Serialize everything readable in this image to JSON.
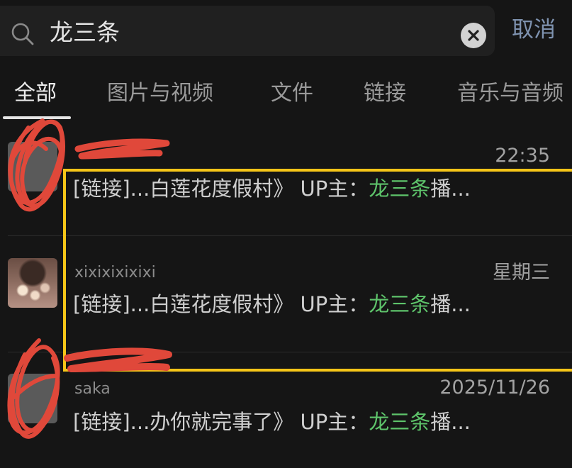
{
  "search": {
    "query": "龙三条",
    "cancel_label": "取消"
  },
  "tabs": [
    {
      "label": "全部",
      "active": true
    },
    {
      "label": "图片与视频",
      "active": false
    },
    {
      "label": "文件",
      "active": false
    },
    {
      "label": "链接",
      "active": false
    },
    {
      "label": "音乐与音频",
      "active": false
    }
  ],
  "results": [
    {
      "name": "",
      "time": "22:35",
      "snippet_prefix": "[链接]...白莲花度假村》 UP主：",
      "snippet_highlight": "龙三条",
      "snippet_suffix": "播..."
    },
    {
      "name": "xixixixixixi",
      "time": "星期三",
      "snippet_prefix": "[链接]...白莲花度假村》 UP主：",
      "snippet_highlight": "龙三条",
      "snippet_suffix": "播..."
    },
    {
      "name": "saka",
      "time": "2025/11/26",
      "snippet_prefix": "[链接]...办你就完事了》 UP主：",
      "snippet_highlight": "龙三条",
      "snippet_suffix": "播..."
    }
  ],
  "colors": {
    "background": "#151515",
    "highlight_text": "#5ec46b",
    "cancel": "#7f93b0",
    "annotation_box": "#f5c518",
    "redaction": "#e0483a"
  },
  "icons": {
    "search": "search-icon",
    "clear": "clear-icon"
  }
}
